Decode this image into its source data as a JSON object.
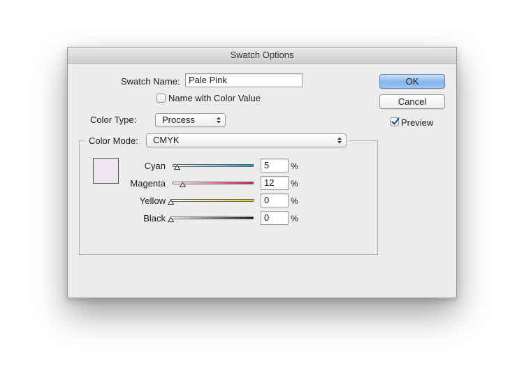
{
  "window": {
    "title": "Swatch Options"
  },
  "swatch_name": {
    "label": "Swatch Name:",
    "value": "Pale Pink"
  },
  "name_with_color_value": {
    "label": "Name with Color Value",
    "checked": false
  },
  "color_type": {
    "label": "Color Type:",
    "value": "Process"
  },
  "color_mode": {
    "label": "Color Mode:",
    "value": "CMYK"
  },
  "swatch_preview_color": "#f1e5f1",
  "channels": [
    {
      "label": "Cyan",
      "value": "5",
      "unit": "%",
      "gradient": [
        "#ffffff",
        "#00a0d2"
      ]
    },
    {
      "label": "Magenta",
      "value": "12",
      "unit": "%",
      "gradient": [
        "#ffffff",
        "#d4145a"
      ]
    },
    {
      "label": "Yellow",
      "value": "0",
      "unit": "%",
      "gradient": [
        "#ffffff",
        "#f5d000"
      ]
    },
    {
      "label": "Black",
      "value": "0",
      "unit": "%",
      "gradient": [
        "#ffffff",
        "#111111"
      ]
    }
  ],
  "buttons": {
    "ok": "OK",
    "cancel": "Cancel"
  },
  "preview": {
    "label": "Preview",
    "checked": true
  }
}
